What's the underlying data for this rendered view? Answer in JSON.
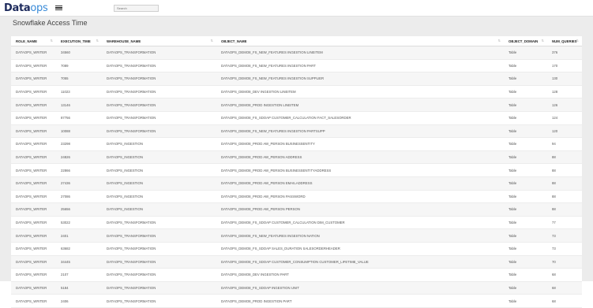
{
  "app": {
    "logo_main": "Data",
    "logo_accent": "ops",
    "search_placeholder": "Search"
  },
  "page": {
    "title": "Snowflake Access Time"
  },
  "table": {
    "columns": [
      "ROLE_NAME",
      "EXECUTION_TIME",
      "WAREHOUSE_NAME",
      "OBJECT_NAME",
      "OBJECT_DOMAIN",
      "NUM_QUERIES"
    ],
    "rows": [
      [
        "DATAOPS_WRITER",
        "34560",
        "DATAOPS_TRANSFORMATION",
        "DATAOPS_DEMO8_FS_NEW_FEATURES INGESTION LINEITEM",
        "Table",
        "376"
      ],
      [
        "DATAOPS_WRITER",
        "7089",
        "DATAOPS_TRANSFORMATION",
        "DATAOPS_DEMO8_FS_NEW_FEATURES INGESTION PART",
        "Table",
        "170"
      ],
      [
        "DATAOPS_WRITER",
        "7055",
        "DATAOPS_TRANSFORMATION",
        "DATAOPS_DEMO8_FS_NEW_FEATURES INGESTION SUPPLIER",
        "Table",
        "130"
      ],
      [
        "DATAOPS_WRITER",
        "11023",
        "DATAOPS_TRANSFORMATION",
        "DATAOPS_DEMO8_DEV INGESTION LINEITEM",
        "Table",
        "128"
      ],
      [
        "DATAOPS_WRITER",
        "13146",
        "DATAOPS_TRANSFORMATION",
        "DATAOPS_DEMO8_PROD INGESTION LINEITEM",
        "Table",
        "126"
      ],
      [
        "DATAOPS_WRITER",
        "87756",
        "DATAOPS_TRANSFORMATION",
        "DATAOPS_DEMO8_FS_SDOAP CUSTOMER_CALCULATION FACT_SALESORDER",
        "Table",
        "124"
      ],
      [
        "DATAOPS_WRITER",
        "10088",
        "DATAOPS_TRANSFORMATION",
        "DATAOPS_DEMO8_FS_NEW_FEATURES INGESTION PARTSUPP",
        "Table",
        "120"
      ],
      [
        "DATAOPS_WRITER",
        "23298",
        "DATAOPS_INGESTION",
        "DATAOPS_DEMO8_PROD AW_PERSON BUSINESSENTITY",
        "Table",
        "94"
      ],
      [
        "DATAOPS_WRITER",
        "24826",
        "DATAOPS_INGESTION",
        "DATAOPS_DEMO8_PROD AW_PERSON ADDRESS",
        "Table",
        "88"
      ],
      [
        "DATAOPS_WRITER",
        "22866",
        "DATAOPS_INGESTION",
        "DATAOPS_DEMO8_PROD AW_PERSON BUSINESSENTITYADDRESS",
        "Table",
        "88"
      ],
      [
        "DATAOPS_WRITER",
        "27436",
        "DATAOPS_INGESTION",
        "DATAOPS_DEMO8_PROD AW_PERSON EMAILADDRESS",
        "Table",
        "88"
      ],
      [
        "DATAOPS_WRITER",
        "27086",
        "DATAOPS_INGESTION",
        "DATAOPS_DEMO8_PROD AW_PERSON PASSWORD",
        "Table",
        "88"
      ],
      [
        "DATAOPS_WRITER",
        "25656",
        "DATAOPS_INGESTION",
        "DATAOPS_DEMO8_PROD AW_PERSON PERSON",
        "Table",
        "88"
      ],
      [
        "DATAOPS_WRITER",
        "53022",
        "DATAOPS_TRANSFORMATION",
        "DATAOPS_DEMO8_FS_SDOAP CUSTOMER_CALCULATION DIM_CUSTOMER",
        "Table",
        "77"
      ],
      [
        "DATAOPS_WRITER",
        "2401",
        "DATAOPS_TRANSFORMATION",
        "DATAOPS_DEMO8_FS_NEW_FEATURES INGESTION NATION",
        "Table",
        "73"
      ],
      [
        "DATAOPS_WRITER",
        "63682",
        "DATAOPS_TRANSFORMATION",
        "DATAOPS_DEMO8_FS_SDOAP SALES_DURATION SALESORDERHEADER",
        "Table",
        "73"
      ],
      [
        "DATAOPS_WRITER",
        "34445",
        "DATAOPS_TRANSFORMATION",
        "DATAOPS_DEMO8_FS_SDOAP CUSTOMER_CONSUMPTION CUSTOMER_LIFETIME_VALUE",
        "Table",
        "70"
      ],
      [
        "DATAOPS_WRITER",
        "2107",
        "DATAOPS_TRANSFORMATION",
        "DATAOPS_DEMO8_DEV INGESTION PART",
        "Table",
        "68"
      ],
      [
        "DATAOPS_WRITER",
        "5184",
        "DATAOPS_TRANSFORMATION",
        "DATAOPS_DEMO8_FS_SDOAP INGESTION UNIT",
        "Table",
        "68"
      ],
      [
        "DATAOPS_WRITER",
        "2406",
        "DATAOPS_TRANSFORMATION",
        "DATAOPS_DEMO8_PROD INGESTION PART",
        "Table",
        "68"
      ]
    ]
  }
}
